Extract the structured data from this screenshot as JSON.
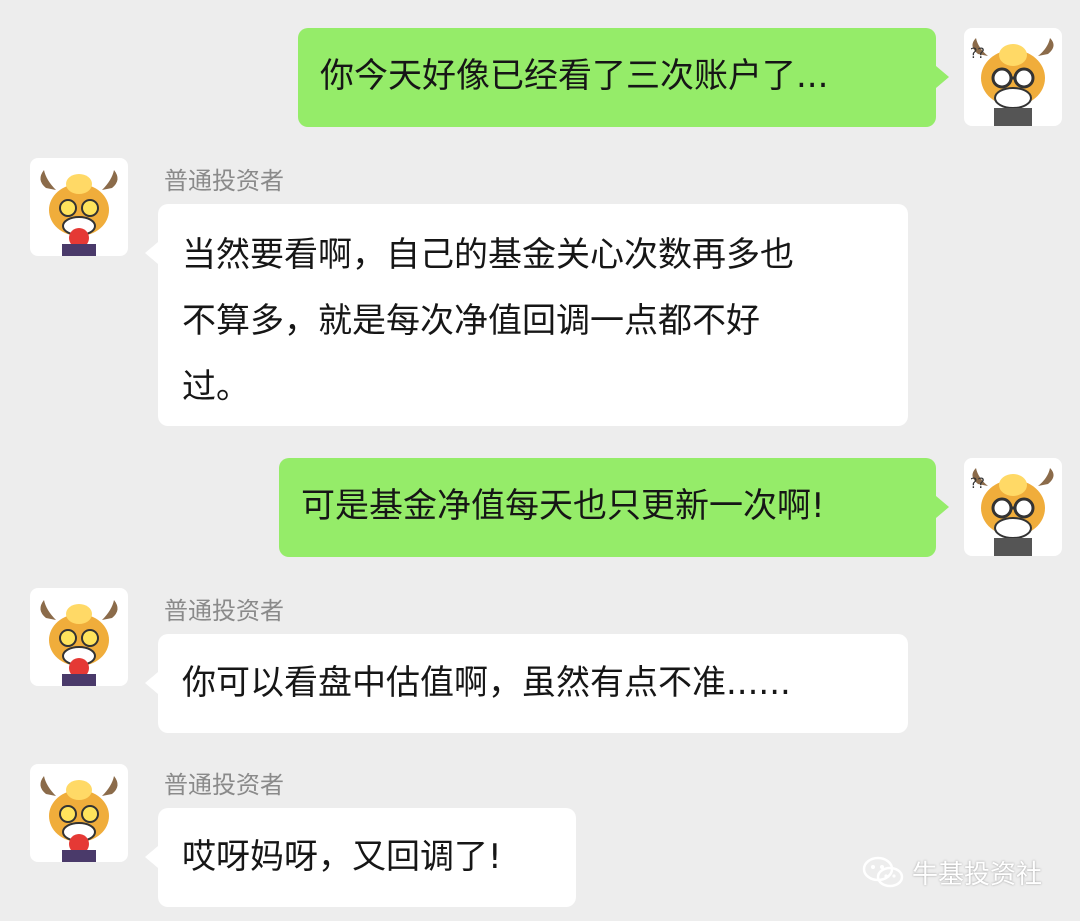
{
  "colors": {
    "background": "#ededed",
    "sent_bubble": "#95ec69",
    "received_bubble": "#ffffff",
    "sender_name": "#8a8a8a"
  },
  "messages": [
    {
      "direction": "sent",
      "avatar": "bull-with-glasses-avatar",
      "lines": [
        "你今天好像已经看了三次账户了..."
      ]
    },
    {
      "direction": "received",
      "sender": "普通投资者",
      "avatar": "bull-with-apple-avatar",
      "lines": [
        "当然要看啊，自己的基金关心次数再多也",
        "不算多，就是每次净值回调一点都不好",
        "过。"
      ]
    },
    {
      "direction": "sent",
      "avatar": "bull-with-glasses-avatar",
      "lines": [
        "可是基金净值每天也只更新一次啊!"
      ]
    },
    {
      "direction": "received",
      "sender": "普通投资者",
      "avatar": "bull-with-apple-avatar",
      "lines": [
        "你可以看盘中估值啊，虽然有点不准......"
      ]
    },
    {
      "direction": "received",
      "sender": "普通投资者",
      "avatar": "bull-with-apple-avatar",
      "lines": [
        "哎呀妈呀，又回调了!"
      ]
    }
  ],
  "watermark": {
    "icon": "wechat-icon",
    "text": "牛基投资社"
  }
}
